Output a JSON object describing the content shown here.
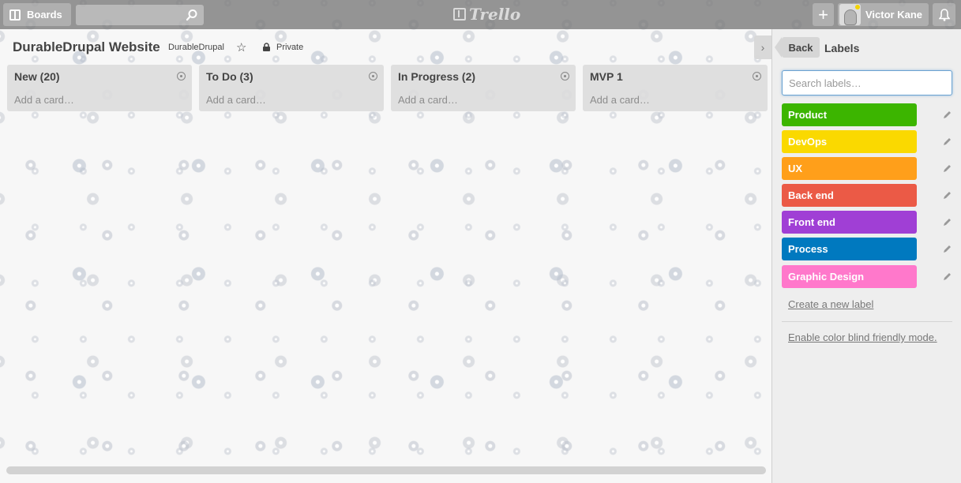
{
  "header": {
    "boards_label": "Boards",
    "logo_text": "Trello",
    "add_label": "+",
    "member_name": "Victor Kane"
  },
  "board": {
    "title": "DurableDrupal Website",
    "team": "DurableDrupal",
    "visibility": "Private"
  },
  "lists": [
    {
      "name": "New (20)",
      "add_card": "Add a card…"
    },
    {
      "name": "To Do (3)",
      "add_card": "Add a card…"
    },
    {
      "name": "In Progress (2)",
      "add_card": "Add a card…"
    },
    {
      "name": "MVP 1",
      "add_card": "Add a card…"
    }
  ],
  "panel": {
    "back_label": "Back",
    "title": "Labels",
    "search_placeholder": "Search labels…",
    "labels": [
      {
        "name": "Product",
        "color": "#3cb500"
      },
      {
        "name": "DevOps",
        "color": "#fad900"
      },
      {
        "name": "UX",
        "color": "#ff9f1a"
      },
      {
        "name": "Back end",
        "color": "#eb5a46"
      },
      {
        "name": "Front end",
        "color": "#a03fd5"
      },
      {
        "name": "Process",
        "color": "#0079bf"
      },
      {
        "name": "Graphic Design",
        "color": "#ff78cb"
      }
    ],
    "create_label": "Create a new label",
    "colorblind_label": "Enable color blind friendly mode."
  },
  "icons": [
    "boards-icon",
    "search-icon",
    "trello-logo-icon",
    "add-icon",
    "avatar",
    "bell-icon",
    "star-icon",
    "lock-icon",
    "list-menu-icon",
    "chevron-right-icon",
    "pencil-icon"
  ]
}
